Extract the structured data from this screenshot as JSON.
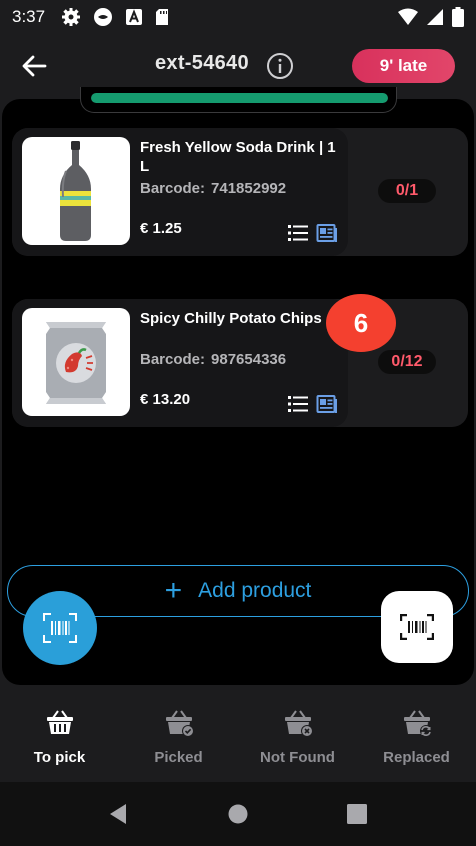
{
  "status_bar": {
    "time": "3:37",
    "icons": [
      "gear-icon",
      "app-bubble-icon",
      "a-box-icon",
      "sd-card-icon",
      "wifi-icon",
      "signal-icon",
      "battery-icon"
    ]
  },
  "header": {
    "order_id": "ext-54640",
    "late_label": "9' late",
    "late_color": "#d8315c"
  },
  "progress": {
    "fraction": 1.0,
    "color": "#159b6f"
  },
  "products": [
    {
      "name": "Fresh Yellow Soda Drink | 1 L",
      "barcode_label": "Barcode:",
      "barcode": "741852992",
      "price": "€ 1.25",
      "quantity": "0/1"
    },
    {
      "name": "Spicy Chilly Potato Chips",
      "barcode_label": "Barcode:",
      "barcode": "987654336",
      "price": "€ 13.20",
      "quantity": "0/12"
    }
  ],
  "count_badge": "6",
  "add_product_label": "Add product",
  "accent_color": "#2d9fe0",
  "tabs": [
    {
      "label": "To pick",
      "icon": "basket-icon",
      "active": true
    },
    {
      "label": "Picked",
      "icon": "basket-check-icon",
      "active": false
    },
    {
      "label": "Not Found",
      "icon": "basket-x-icon",
      "active": false
    },
    {
      "label": "Replaced",
      "icon": "basket-swap-icon",
      "active": false
    }
  ]
}
